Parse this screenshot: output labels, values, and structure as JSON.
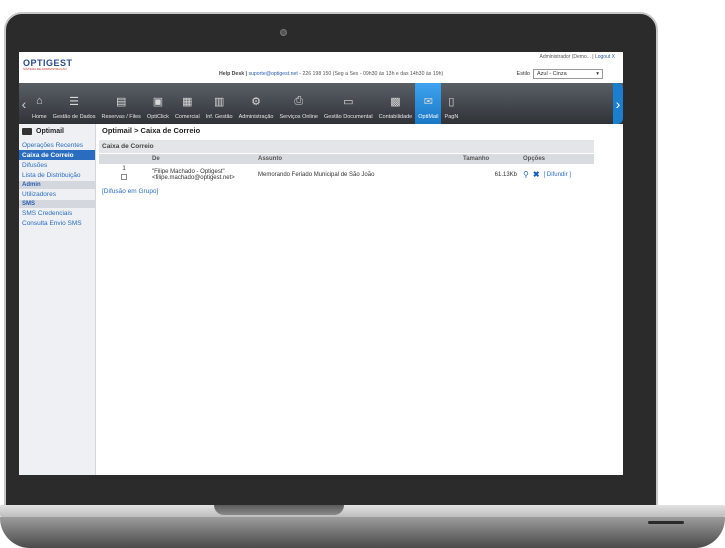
{
  "topbar": {
    "logo": {
      "name": "OPTIGEST",
      "tagline": "SISTEMA DE ADMINISTRAÇÃO"
    },
    "user_text": "Administrador (Demo... |",
    "logout_label": "Logout X",
    "helpdesk_label": "Help Desk |",
    "helpdesk_email": "suporte@optigest.net",
    "helpdesk_info": "- 226 198 150 (Seg a Sex - 09h30 às 13h e das 14h30 às 19h)",
    "estilo_label": "Estilo",
    "estilo_value": "Azul - Cinza"
  },
  "toolbar": {
    "items": [
      {
        "label": "Home",
        "icon": "home-icon"
      },
      {
        "label": "Gestão de Dados",
        "icon": "list-icon"
      },
      {
        "label": "Reservas / Files",
        "icon": "files-icon"
      },
      {
        "label": "OptiClick",
        "icon": "click-icon"
      },
      {
        "label": "Comercial",
        "icon": "commercial-icon"
      },
      {
        "label": "Inf. Gestão",
        "icon": "chart-icon"
      },
      {
        "label": "Administração",
        "icon": "gears-icon"
      },
      {
        "label": "Serviços Online",
        "icon": "printer-icon"
      },
      {
        "label": "Gestão Documental",
        "icon": "book-icon"
      },
      {
        "label": "Contabilidade",
        "icon": "calculator-icon"
      },
      {
        "label": "OptiMail",
        "icon": "mail-icon"
      },
      {
        "label": "PagN",
        "icon": "doc-icon"
      }
    ],
    "active": "OptiMail"
  },
  "sidebar": {
    "title": "Optimail",
    "links_top": [
      "Operações Recentes",
      "Caixa de Correio",
      "Difusões",
      "Lista de Distribuição"
    ],
    "active": "Caixa de Correio",
    "section_admin": "Admin",
    "links_admin": [
      "Utilizadores"
    ],
    "section_sms": "SMS",
    "links_sms": [
      "SMS Credenciais",
      "Consulta Envio SMS"
    ]
  },
  "main": {
    "breadcrumb": "Optimail > Caixa de Correio",
    "panel_title": "Caixa de Correio",
    "columns": [
      "",
      "De",
      "Assunto",
      "Tamanho",
      "Opções"
    ],
    "rows": [
      {
        "num": "1",
        "from_name": "\"Filipe Machado - Optigest\"",
        "from_email": "<filipe.machado@optigest.net>",
        "subject": "Memorando Feriado Municipal de São João",
        "size": "61.13Kb",
        "option_link": "[ Difundir ]"
      }
    ],
    "group_link": "[Difusão em Grupo]"
  },
  "colors": {
    "toolbar_dark": "#2f3338",
    "accent_blue": "#1a78c6",
    "link_blue": "#2a6cc0",
    "sidebar_bg": "#eef0f3"
  }
}
